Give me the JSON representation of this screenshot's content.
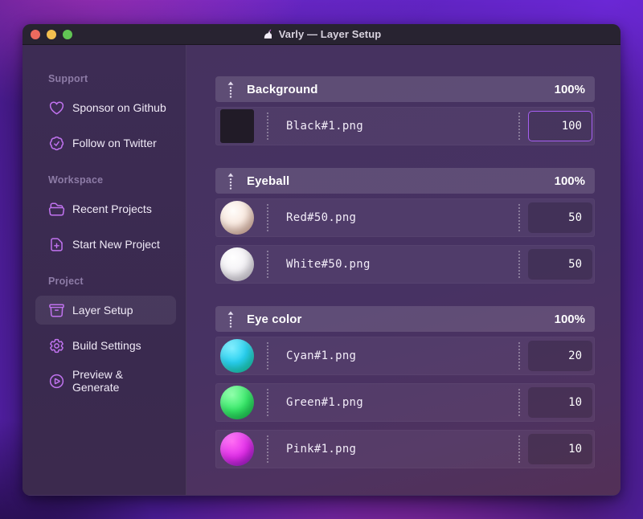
{
  "window": {
    "title": "Varly — Layer Setup",
    "app_icon": "unicorn-icon",
    "traffic_lights": [
      "close",
      "minimize",
      "zoom"
    ]
  },
  "sidebar": {
    "sections": [
      {
        "label": "Support",
        "items": [
          {
            "icon": "heart-icon",
            "label": "Sponsor on Github",
            "active": false
          },
          {
            "icon": "badge-check-icon",
            "label": "Follow on Twitter",
            "active": false
          }
        ]
      },
      {
        "label": "Workspace",
        "items": [
          {
            "icon": "folder-open-icon",
            "label": "Recent Projects",
            "active": false
          },
          {
            "icon": "document-plus-icon",
            "label": "Start New Project",
            "active": false
          }
        ]
      },
      {
        "label": "Project",
        "items": [
          {
            "icon": "archive-box-icon",
            "label": "Layer Setup",
            "active": true
          },
          {
            "icon": "gear-icon",
            "label": "Build Settings",
            "active": false
          },
          {
            "icon": "play-circle-icon",
            "label": "Preview & Generate",
            "active": false
          }
        ]
      }
    ]
  },
  "layers": {
    "groups": [
      {
        "name": "Background",
        "weight": "100%",
        "items": [
          {
            "file": "Black#1.png",
            "value": "100",
            "thumb": "black-square",
            "focused": true
          }
        ]
      },
      {
        "name": "Eyeball",
        "weight": "100%",
        "items": [
          {
            "file": "Red#50.png",
            "value": "50",
            "thumb": "red-sphere",
            "focused": false
          },
          {
            "file": "White#50.png",
            "value": "50",
            "thumb": "white-sphere",
            "focused": false
          }
        ]
      },
      {
        "name": "Eye color",
        "weight": "100%",
        "items": [
          {
            "file": "Cyan#1.png",
            "value": "20",
            "thumb": "cyan-sphere",
            "focused": false
          },
          {
            "file": "Green#1.png",
            "value": "10",
            "thumb": "green-sphere",
            "focused": false
          },
          {
            "file": "Pink#1.png",
            "value": "10",
            "thumb": "pink-sphere",
            "focused": false
          }
        ]
      }
    ]
  },
  "colors": {
    "accent": "#c173f0",
    "focus_border": "#a65ef2",
    "traffic_red": "#ec6a5e",
    "traffic_yellow": "#f4bf4f",
    "traffic_green": "#61c554"
  }
}
